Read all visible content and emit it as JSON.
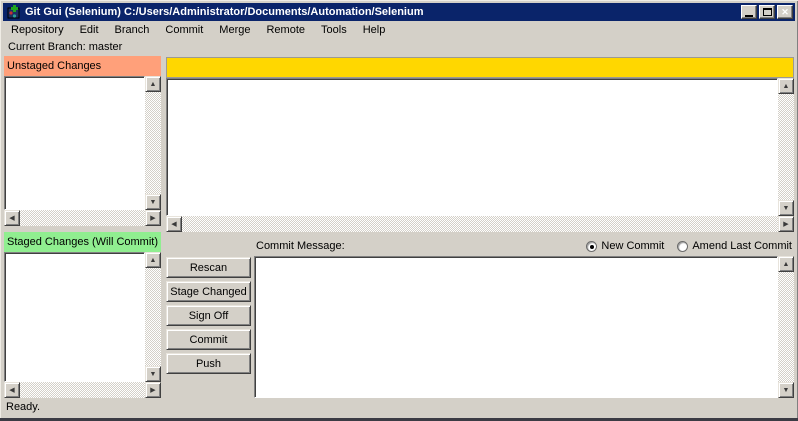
{
  "window": {
    "title": "Git Gui (Selenium) C:/Users/Administrator/Documents/Automation/Selenium"
  },
  "menu": {
    "items": [
      "Repository",
      "Edit",
      "Branch",
      "Commit",
      "Merge",
      "Remote",
      "Tools",
      "Help"
    ]
  },
  "branch_label": "Current Branch: master",
  "panels": {
    "unstaged": {
      "header": "Unstaged Changes",
      "files": []
    },
    "staged": {
      "header": "Staged Changes (Will Commit)",
      "files": []
    },
    "diff": {
      "content": ""
    }
  },
  "commit_area": {
    "label": "Commit Message:",
    "radio_new": "New Commit",
    "radio_new_selected": true,
    "radio_amend": "Amend Last Commit",
    "radio_amend_selected": false,
    "buttons": [
      "Rescan",
      "Stage Changed",
      "Sign Off",
      "Commit",
      "Push"
    ],
    "message_value": ""
  },
  "status": "Ready.",
  "icons": {
    "up": "▲",
    "down": "▼",
    "left": "◀",
    "right": "▶",
    "close": "✕"
  },
  "colors": {
    "titlebar": "#0a246a",
    "window_bg": "#d4d0c8",
    "unstaged_header": "#ffa07a",
    "staged_header": "#90ee90",
    "diff_header": "#ffd700"
  }
}
